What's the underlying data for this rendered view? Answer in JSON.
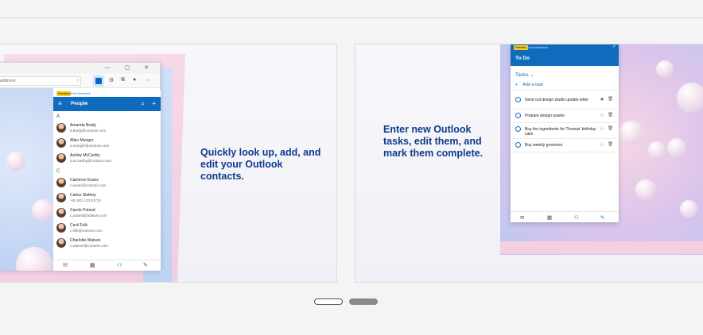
{
  "slides": [
    {
      "caption_lines": [
        "Quickly look up, add, and",
        "edit your Outlook",
        "contacts."
      ],
      "browser": {
        "address_placeholder": "address",
        "window_controls": "— ▢ ✕"
      },
      "panel": {
        "preview_badge": "Preview",
        "feedback_link": "Send feedback",
        "title": "People",
        "groups": [
          {
            "letter": "A",
            "contacts": [
              {
                "name": "Amanda Brady",
                "email": "a.brady@contoso.com"
              },
              {
                "name": "Allan Munger",
                "email": "a.munger@contoso.com"
              },
              {
                "name": "Ashley McCarthy",
                "email": "a.mccarthy@contoso.com"
              }
            ]
          },
          {
            "letter": "C",
            "contacts": [
              {
                "name": "Cameron Evans",
                "email": "c.evans@contoso.com"
              },
              {
                "name": "Carlos Slattery",
                "email": "+91 921 133 91710"
              },
              {
                "name": "Carole Poland",
                "email": "c.poland@adatum.com"
              },
              {
                "name": "Cecil Folk",
                "email": "c.folk@contoso.com"
              },
              {
                "name": "Charlotte Watson",
                "email": "c.watson@contoso.com"
              }
            ]
          }
        ]
      }
    },
    {
      "caption_lines": [
        "Enter new Outlook",
        "tasks, edit them, and",
        "mark them complete."
      ],
      "todo": {
        "preview_badge": "Preview",
        "feedback_link": "Send feedback",
        "title": "To Do",
        "list_name": "Tasks",
        "add_task": "Add a task",
        "tasks": [
          {
            "text": "Send out design studio update letter",
            "starred": true
          },
          {
            "text": "Prepare design assets",
            "starred": false
          },
          {
            "text": "Buy the ingredients for Thomas' birthday cake",
            "starred": false
          },
          {
            "text": "Buy weekly groceries",
            "starred": false
          }
        ]
      }
    }
  ],
  "pager": {
    "count": 2,
    "active": 0
  },
  "colors": {
    "accent": "#0f6cbd",
    "caption": "#0e3a8c"
  }
}
